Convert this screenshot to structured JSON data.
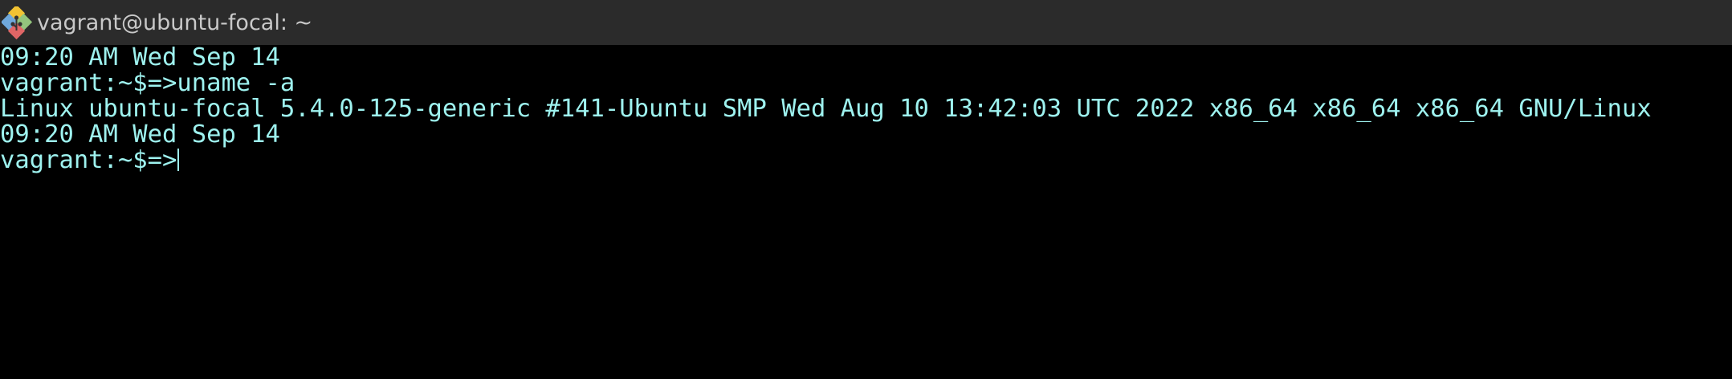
{
  "window": {
    "title": "vagrant@ubuntu-focal: ~",
    "app_icon": "git-bash-icon"
  },
  "terminal": {
    "lines": [
      "09:20 AM Wed Sep 14",
      "vagrant:~$=>uname -a",
      "Linux ubuntu-focal 5.4.0-125-generic #141-Ubuntu SMP Wed Aug 10 13:42:03 UTC 2022 x86_64 x86_64 x86_64 GNU/Linux",
      "09:20 AM Wed Sep 14"
    ],
    "prompt": "vagrant:~$=>"
  },
  "colors": {
    "titlebar_bg": "#2b2b2b",
    "title_text": "#c9c9c9",
    "terminal_bg": "#000000",
    "terminal_text": "#9ef2ef"
  }
}
